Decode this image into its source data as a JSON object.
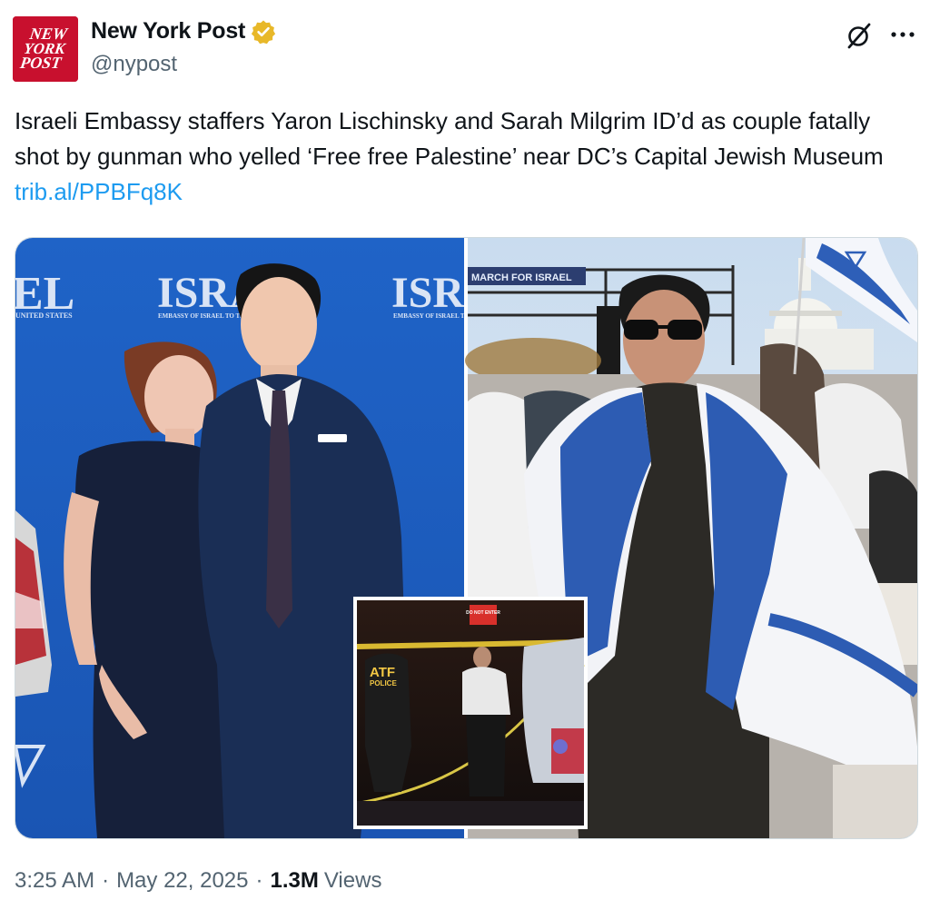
{
  "author": {
    "display_name": "New York Post",
    "handle": "@nypost",
    "logo_text": [
      "NEW",
      "YORK",
      "POST"
    ],
    "verified": true,
    "verified_color": "#e8b829"
  },
  "tweet": {
    "text": "Israeli Embassy staffers Yaron Lischinsky and Sarah Milgrim ID’d as couple fatally shot by gunman who yelled ‘Free free Palestine’ near DC’s Capital Jewish Museum ",
    "link": "trib.al/PPBFq8K"
  },
  "media": {
    "left_photo": {
      "backdrop_text": "ISRAEL",
      "backdrop_subtext": "EMBASSY OF ISRAEL TO THE",
      "backdrop_left_text": "EL",
      "backdrop_left_subtext": "UNITED STATES"
    },
    "right_photo": {
      "banner_text": "MARCH FOR ISRAEL"
    },
    "inset_photo": {
      "vest_text": "ATF",
      "vest_subtext": "POLICE",
      "sign_text": "DO NOT ENTER"
    }
  },
  "footer": {
    "time": "3:25 AM",
    "separator": "·",
    "date": "May 22, 2025",
    "views_count": "1.3M",
    "views_label": "Views"
  },
  "icons": {
    "grok": "grok-icon",
    "more": "more-icon",
    "verified": "verified-badge-icon"
  },
  "colors": {
    "brand_red": "#c8102e",
    "link": "#1d9bf0",
    "secondary_text": "#536471",
    "primary_text": "#0f1419"
  }
}
